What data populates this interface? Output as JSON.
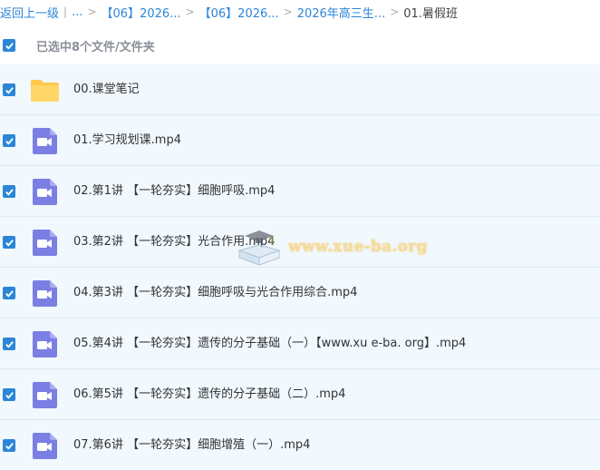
{
  "breadcrumb": {
    "back": "返回上一级",
    "ellipsis": "...",
    "items": [
      "【06】2026...",
      "【06】2026...",
      "2026年高三生..."
    ],
    "current": "01.暑假班",
    "separator": ">"
  },
  "selection": {
    "label": "已选中8个文件/文件夹",
    "checked": true
  },
  "files": [
    {
      "name": "00.课堂笔记",
      "type": "folder"
    },
    {
      "name": "01.学习规划课.mp4",
      "type": "video"
    },
    {
      "name": "02.第1讲 【一轮夯实】细胞呼吸.mp4",
      "type": "video"
    },
    {
      "name": "03.第2讲 【一轮夯实】光合作用.mp4",
      "type": "video"
    },
    {
      "name": "04.第3讲 【一轮夯实】细胞呼吸与光合作用综合.mp4",
      "type": "video"
    },
    {
      "name": "05.第4讲 【一轮夯实】遗传的分子基础（一）【www.xu e-ba. org】.mp4",
      "type": "video"
    },
    {
      "name": "06.第5讲 【一轮夯实】遗传的分子基础（二）.mp4",
      "type": "video"
    },
    {
      "name": "07.第6讲 【一轮夯实】细胞增殖（一）.mp4",
      "type": "video"
    }
  ],
  "watermark": "www.xue-ba.org",
  "colors": {
    "accent": "#2b86d7",
    "row_bg": "#f1f8fe",
    "video_icon": "#7b7fe3",
    "folder_icon": "#ffc94d"
  }
}
